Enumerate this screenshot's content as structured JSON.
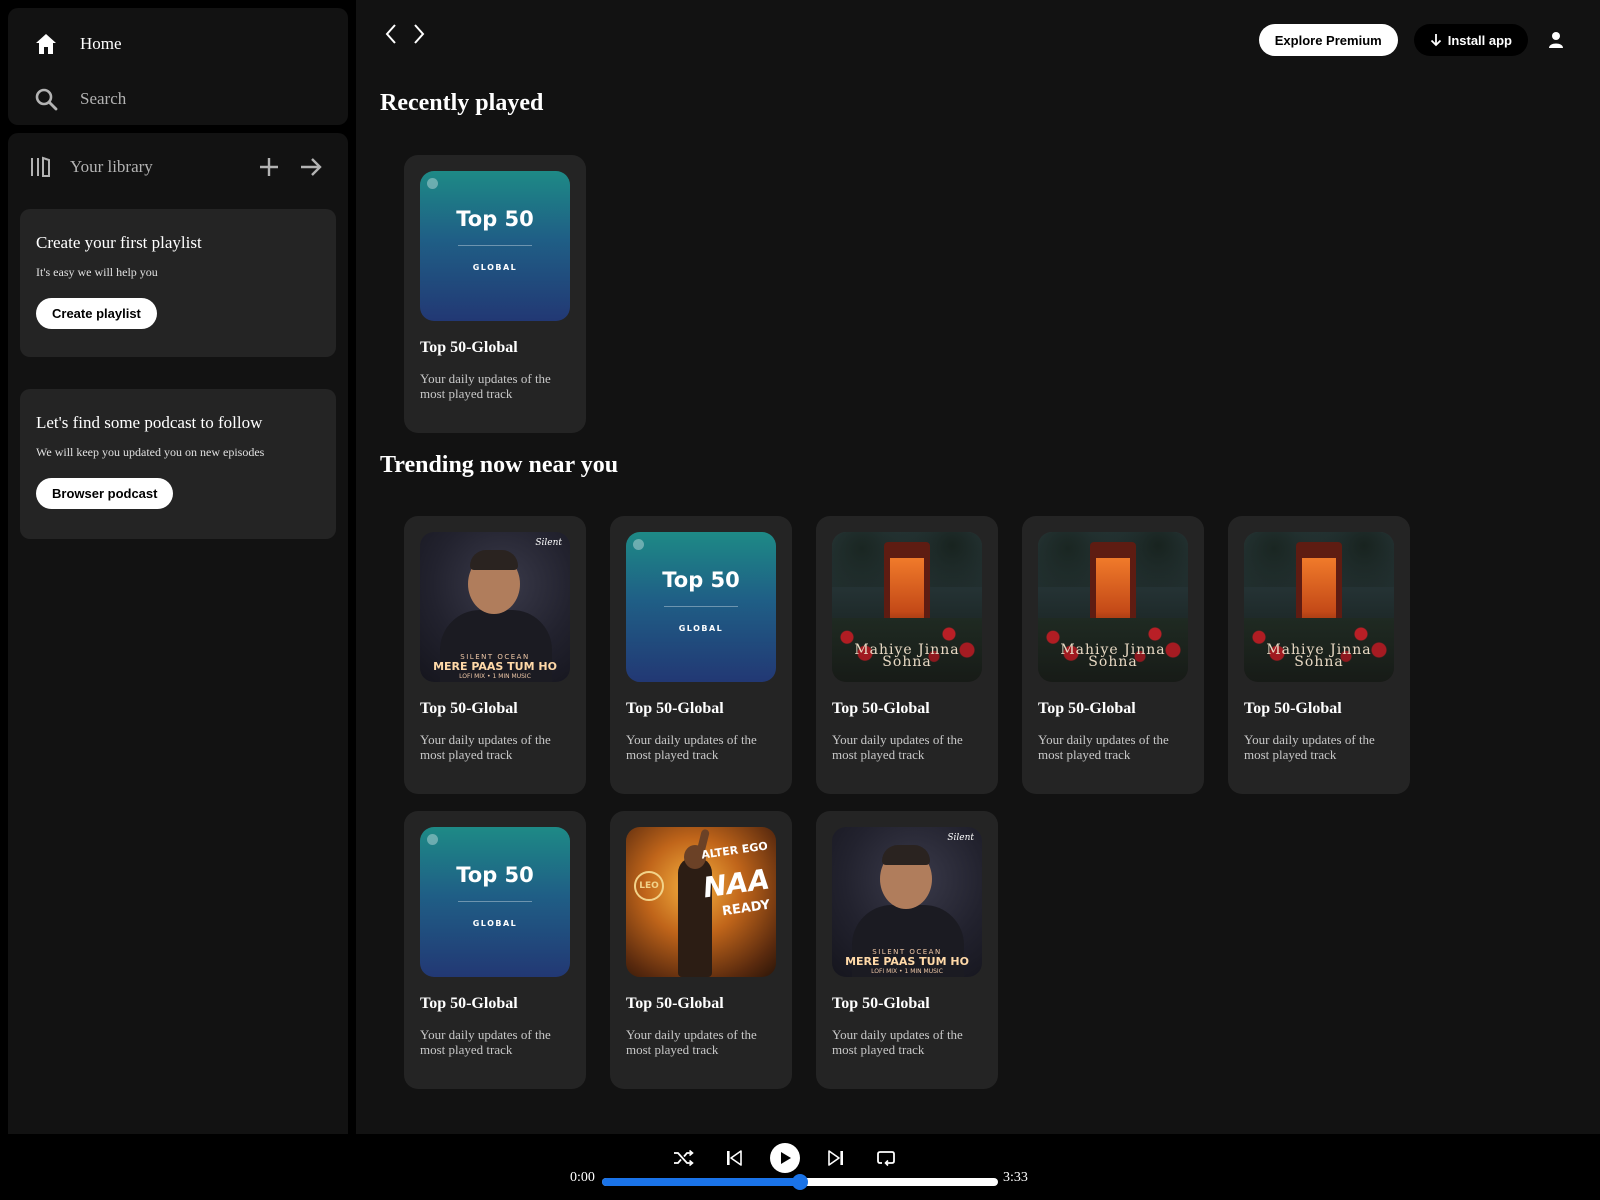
{
  "colors": {
    "accent": "#1a73e8",
    "surface": "#121212",
    "card": "#242424",
    "background": "#000000"
  },
  "nav": {
    "home": {
      "label": "Home",
      "icon": "home-icon"
    },
    "search": {
      "label": "Search",
      "icon": "search-icon"
    }
  },
  "library": {
    "title": "Your library",
    "icon": "library-icon",
    "add_icon": "plus-icon",
    "expand_icon": "arrow-right-icon",
    "promos": [
      {
        "title": "Create your first playlist",
        "text": "It's easy we will help you",
        "button": "Create playlist"
      },
      {
        "title": "Let's find some podcast to follow",
        "text": "We will keep you updated you on new episodes",
        "button": "Browser podcast"
      }
    ]
  },
  "header": {
    "back_icon": "chevron-left-icon",
    "forward_icon": "chevron-right-icon",
    "explore_premium": "Explore Premium",
    "install_app": "Install app",
    "user_icon": "user-icon"
  },
  "sections": {
    "recent_title": "Recently played",
    "trending_title": "Trending now near you"
  },
  "covers": {
    "top50_title": "Top 50",
    "top50_sub": "GLOBAL",
    "merepaas_sig": "Silent",
    "merepaas_artist": "SILENT OCEAN",
    "merepaas_title": "MERE PAAS TUM HO",
    "merepaas_sub": "LOFI MIX • 1 MIN MUSIC",
    "mahiye_title_1": "Mahiye Jinna",
    "mahiye_title_2": "Sohna",
    "leo_badge": "LEO",
    "leo_alter": "ALTER EGO",
    "leo_naa": "NAA",
    "leo_ready": "READY"
  },
  "recent": [
    {
      "cover": "top50",
      "title": "Top 50-Global",
      "desc": "Your daily updates of the most played track"
    }
  ],
  "trending": [
    {
      "cover": "merepaas",
      "title": "Top 50-Global",
      "desc": "Your daily updates of the most played track"
    },
    {
      "cover": "top50",
      "title": "Top 50-Global",
      "desc": "Your daily updates of the most played track"
    },
    {
      "cover": "mahiye",
      "title": "Top 50-Global",
      "desc": "Your daily updates of the most played track"
    },
    {
      "cover": "mahiye",
      "title": "Top 50-Global",
      "desc": "Your daily updates of the most played track"
    },
    {
      "cover": "mahiye",
      "title": "Top 50-Global",
      "desc": "Your daily updates of the most played track"
    },
    {
      "cover": "top50",
      "title": "Top 50-Global",
      "desc": "Your daily updates of the most played track"
    },
    {
      "cover": "leo",
      "title": "Top 50-Global",
      "desc": "Your daily updates of the most played track"
    },
    {
      "cover": "merepaas",
      "title": "Top 50-Global",
      "desc": "Your daily updates of the most played track"
    }
  ],
  "player": {
    "current_time": "0:00",
    "total_time": "3:33",
    "progress": 0.5,
    "icons": [
      "shuffle-icon",
      "previous-icon",
      "play-icon",
      "next-icon",
      "repeat-icon"
    ]
  }
}
